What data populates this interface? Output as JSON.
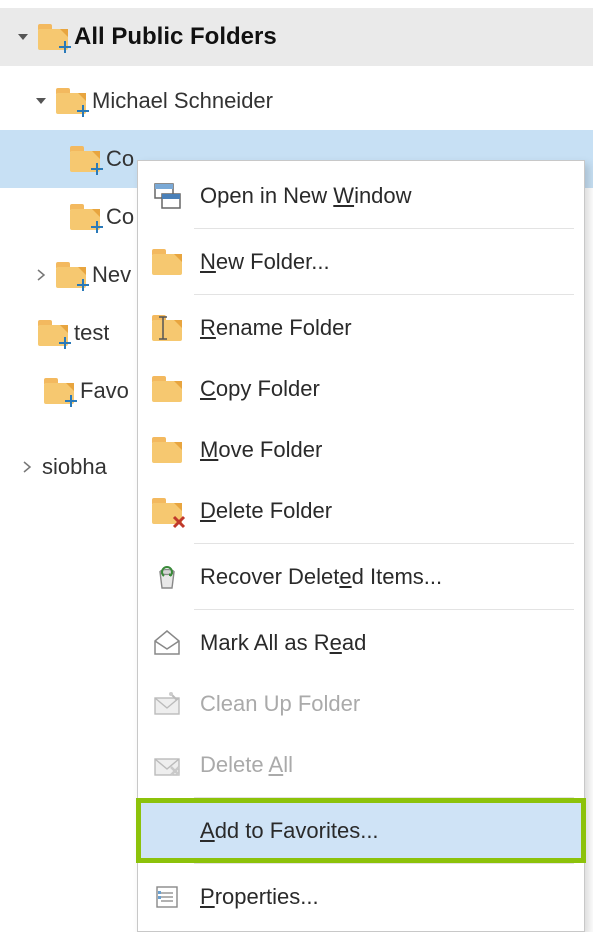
{
  "tree": {
    "root_label": "All Public Folders",
    "items": [
      {
        "label": "Michael Schneider",
        "indent": 1,
        "expanded": true,
        "has_children": true
      },
      {
        "label": "Co",
        "indent": 2,
        "selected": true
      },
      {
        "label": "Co",
        "indent": 2
      },
      {
        "label": "Nev",
        "indent": 1,
        "has_children": true,
        "expanded": false
      },
      {
        "label": "test",
        "indent": 1
      },
      {
        "label": "Favo",
        "indent": 1
      }
    ],
    "sibling_label": "siobha"
  },
  "menu": {
    "items": [
      {
        "id": "open-new-window",
        "label": "Open in New Window",
        "accel": "W",
        "icon": "new-window"
      },
      {
        "id": "new-folder",
        "label": "New Folder...",
        "accel": "N",
        "icon": "folder"
      },
      {
        "id": "rename-folder",
        "label": "Rename Folder",
        "accel": "R",
        "icon": "folder-rename"
      },
      {
        "id": "copy-folder",
        "label": "Copy Folder",
        "accel": "C",
        "icon": "folder"
      },
      {
        "id": "move-folder",
        "label": "Move Folder",
        "accel": "M",
        "icon": "folder"
      },
      {
        "id": "delete-folder",
        "label": "Delete Folder",
        "accel": "D",
        "icon": "folder-delete"
      },
      {
        "id": "recover-deleted",
        "label": "Recover Deleted Items...",
        "accel": "e",
        "icon": "recycle"
      },
      {
        "id": "mark-all-read",
        "label": "Mark All as Read",
        "accel": "e",
        "icon": "envelope-open"
      },
      {
        "id": "clean-up",
        "label": "Clean Up Folder",
        "accel": "",
        "icon": "envelope-clean",
        "disabled": true
      },
      {
        "id": "delete-all",
        "label": "Delete All",
        "accel": "A",
        "icon": "envelope-delete",
        "disabled": true
      },
      {
        "id": "add-favorites",
        "label": "Add to Favorites...",
        "accel": "A",
        "icon": "",
        "hover": true,
        "highlight": true
      },
      {
        "id": "properties",
        "label": "Properties...",
        "accel": "P",
        "icon": "properties"
      }
    ]
  }
}
